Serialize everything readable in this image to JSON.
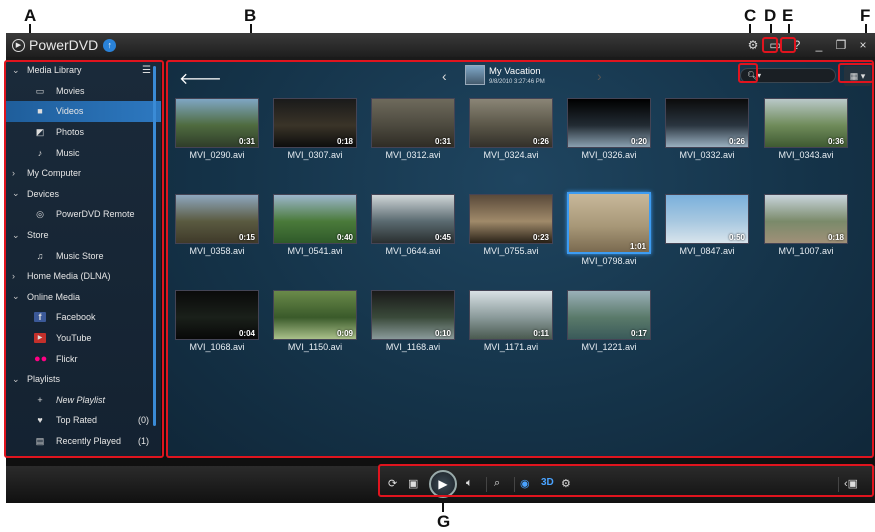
{
  "callouts": {
    "a": "A",
    "b": "B",
    "c": "C",
    "d": "D",
    "e": "E",
    "f": "F",
    "g": "G"
  },
  "app": {
    "name": "PowerDVD",
    "update_icon": "up-arrow-icon"
  },
  "window_controls": {
    "help": "?",
    "minimize": "_",
    "restore": "❐",
    "close": "×"
  },
  "sidebar": {
    "items": [
      {
        "label": "Media Library",
        "type": "section",
        "expanded": true
      },
      {
        "label": "Movies",
        "type": "sub",
        "icon": "movie-icon"
      },
      {
        "label": "Videos",
        "type": "sub",
        "icon": "video-icon",
        "active": true
      },
      {
        "label": "Photos",
        "type": "sub",
        "icon": "photo-icon"
      },
      {
        "label": "Music",
        "type": "sub",
        "icon": "music-icon"
      },
      {
        "label": "My Computer",
        "type": "section",
        "expanded": false
      },
      {
        "label": "Devices",
        "type": "section",
        "expanded": true
      },
      {
        "label": "PowerDVD Remote",
        "type": "sub",
        "icon": "remote-icon"
      },
      {
        "label": "Store",
        "type": "section",
        "expanded": true
      },
      {
        "label": "Music Store",
        "type": "sub",
        "icon": "music-store-icon"
      },
      {
        "label": "Home Media (DLNA)",
        "type": "section",
        "expanded": false
      },
      {
        "label": "Online Media",
        "type": "section",
        "expanded": true
      },
      {
        "label": "Facebook",
        "type": "sub",
        "icon": "facebook-icon"
      },
      {
        "label": "YouTube",
        "type": "sub",
        "icon": "youtube-icon"
      },
      {
        "label": "Flickr",
        "type": "sub",
        "icon": "flickr-icon"
      },
      {
        "label": "Playlists",
        "type": "section",
        "expanded": true
      },
      {
        "label": "New Playlist",
        "type": "sub",
        "icon": "plus-icon",
        "italic": true
      },
      {
        "label": "Top Rated",
        "type": "sub",
        "icon": "heart-icon",
        "count": "(0)"
      },
      {
        "label": "Recently Played",
        "type": "sub",
        "icon": "recent-icon",
        "count": "(1)"
      }
    ]
  },
  "main": {
    "album_title": "My Vacation",
    "album_date": "9/8/2010 3:27:46 PM",
    "search_icon": "search-icon",
    "view_icon": "grid-view-icon"
  },
  "thumbnails": [
    {
      "name": "MVI_0290.avi",
      "duration": "0:31",
      "colors": [
        "#7fa6c4",
        "#4f6b3f",
        "#2f3d2a"
      ]
    },
    {
      "name": "MVI_0307.avi",
      "duration": "0:18",
      "colors": [
        "#1a1a1a",
        "#3a3428",
        "#0d0d0d"
      ]
    },
    {
      "name": "MVI_0312.avi",
      "duration": "0:31",
      "colors": [
        "#6e6a5c",
        "#4d4a3f",
        "#2f2c25"
      ]
    },
    {
      "name": "MVI_0324.avi",
      "duration": "0:26",
      "colors": [
        "#8a8576",
        "#5a5648",
        "#33302a"
      ]
    },
    {
      "name": "MVI_0326.avi",
      "duration": "0:20",
      "colors": [
        "#000000",
        "#222b33",
        "#8aa0b0"
      ]
    },
    {
      "name": "MVI_0332.avi",
      "duration": "0:26",
      "colors": [
        "#0b0b0b",
        "#2a3540",
        "#9ab0c0"
      ]
    },
    {
      "name": "MVI_0343.avi",
      "duration": "0:36",
      "colors": [
        "#b9c8c8",
        "#6f8b5a",
        "#3f5a32"
      ]
    },
    {
      "name": "MVI_0358.avi",
      "duration": "0:15",
      "colors": [
        "#8ea7bf",
        "#5a5a40",
        "#3f3a2a"
      ]
    },
    {
      "name": "MVI_0541.avi",
      "duration": "0:40",
      "colors": [
        "#9cb6cc",
        "#4a7a3a",
        "#2f5a2a"
      ]
    },
    {
      "name": "MVI_0644.avi",
      "duration": "0:45",
      "colors": [
        "#d0d6d8",
        "#5a6a70",
        "#2a2f30"
      ]
    },
    {
      "name": "MVI_0755.avi",
      "duration": "0:23",
      "colors": [
        "#5a4a3a",
        "#a08a6a",
        "#2a2218"
      ]
    },
    {
      "name": "MVI_0798.avi",
      "duration": "1:01",
      "colors": [
        "#c8b89a",
        "#a89878",
        "#7a6a50"
      ]
    },
    {
      "name": "MVI_0847.avi",
      "duration": "0:50",
      "colors": [
        "#7ab0dc",
        "#a8c8e0",
        "#d8e4ec"
      ]
    },
    {
      "name": "MVI_1007.avi",
      "duration": "0:18",
      "colors": [
        "#c8d4dc",
        "#7a8a6a",
        "#a09078"
      ]
    },
    {
      "name": "MVI_1068.avi",
      "duration": "0:04",
      "colors": [
        "#0a0a0a",
        "#1a201a",
        "#080808"
      ]
    },
    {
      "name": "MVI_1150.avi",
      "duration": "0:09",
      "colors": [
        "#6a8a4a",
        "#3a5a2a",
        "#aac08a"
      ]
    },
    {
      "name": "MVI_1168.avi",
      "duration": "0:10",
      "colors": [
        "#1a1a1a",
        "#3a4a3a",
        "#8a9a9a"
      ]
    },
    {
      "name": "MVI_1171.avi",
      "duration": "0:11",
      "colors": [
        "#d8e0e4",
        "#8a9a9a",
        "#4a5a50"
      ]
    },
    {
      "name": "MVI_1221.avi",
      "duration": "0:17",
      "colors": [
        "#9ab0b8",
        "#5a7a6a",
        "#3a5a5a"
      ]
    }
  ],
  "bottom_controls": {
    "three_d_label": "3D"
  }
}
